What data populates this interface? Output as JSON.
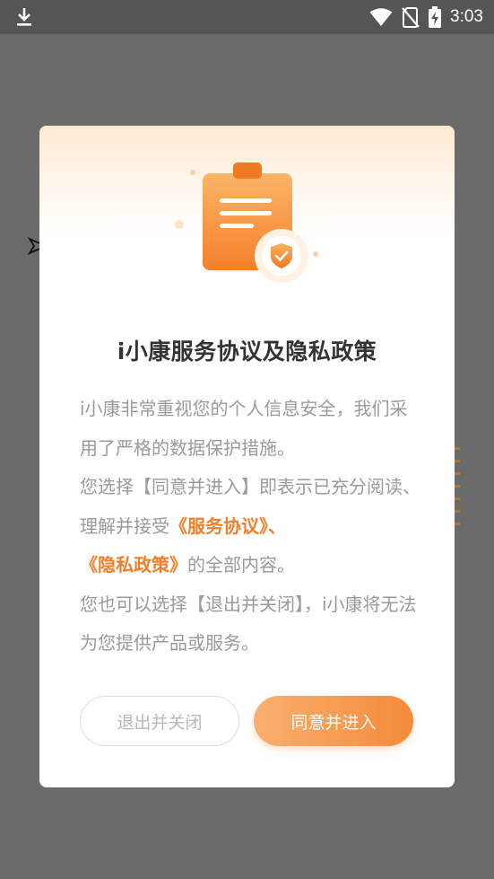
{
  "status_bar": {
    "time": "3:03",
    "icons": [
      "download-icon",
      "wifi-icon",
      "no-sim-icon",
      "battery-charging-icon"
    ]
  },
  "dialog": {
    "illustration_icon": "clipboard-shield-icon",
    "title": "i小康服务协议及隐私政策",
    "body": {
      "para1": "i小康非常重视您的个人信息安全，我们采用了严格的数据保护措施。",
      "para2_before": "您选择【同意并进入】即表示已充分阅读、理解并接受",
      "service_agreement_link": "《服务协议》、",
      "privacy_policy_link": "《隐私政策》",
      "para2_after": "的全部内容。",
      "para3": "您也可以选择【退出并关闭】，i小康将无法为您提供产品或服务。"
    },
    "buttons": {
      "exit_label": "退出并关闭",
      "agree_label": "同意并进入"
    }
  },
  "colors": {
    "accent": "#f58a3a",
    "overlay": "#6b6b6b",
    "status_bar": "#555555",
    "body_text": "#9a9a9a",
    "title_text": "#333333"
  }
}
